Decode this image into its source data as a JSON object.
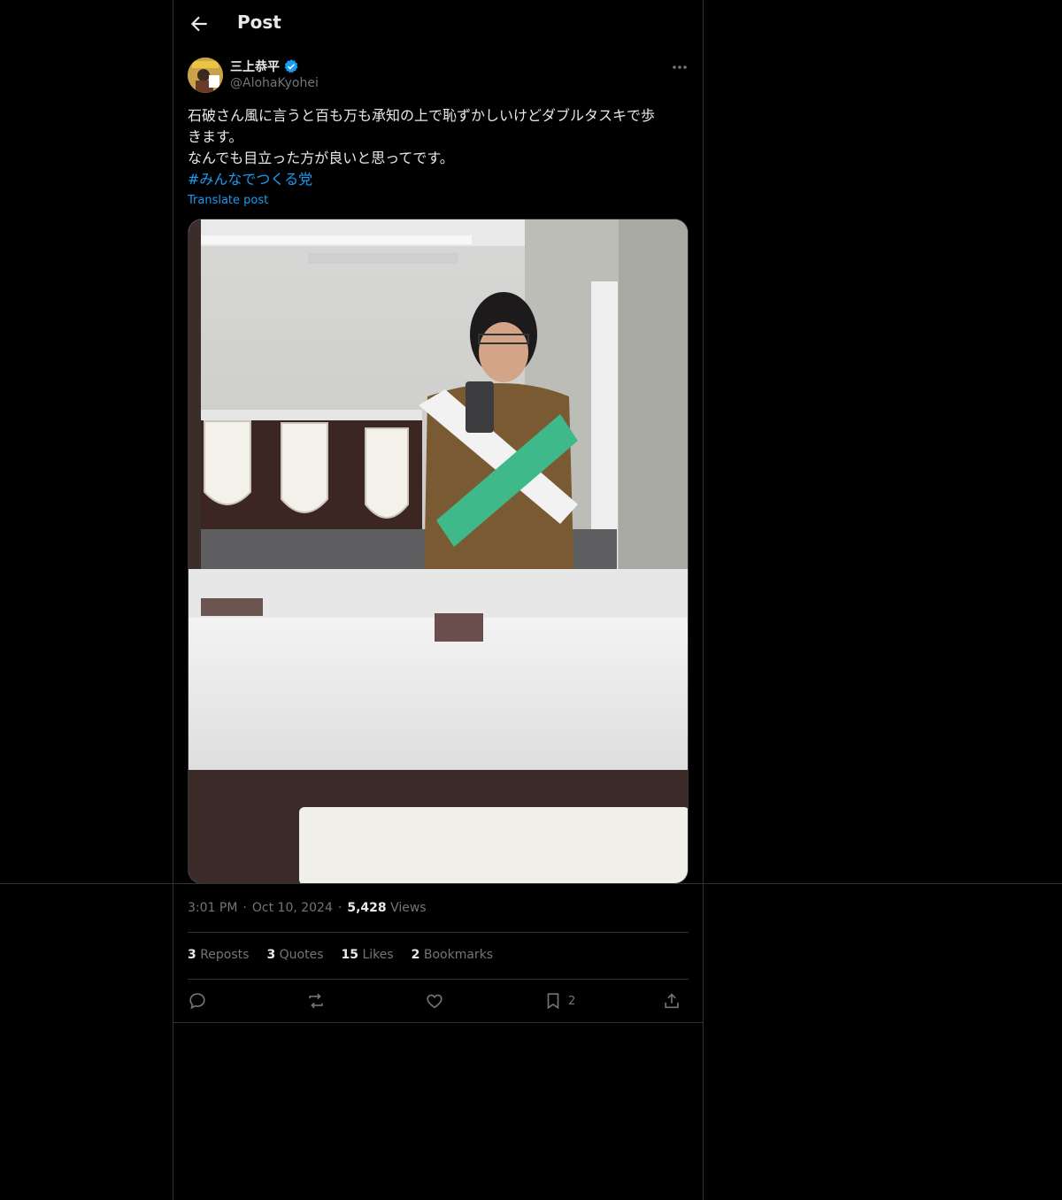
{
  "header": {
    "title": "Post",
    "back_icon": "arrow-left-icon"
  },
  "author": {
    "name": "三上恭平",
    "handle": "@AlohaKyohei",
    "verified": true
  },
  "post": {
    "lines": [
      "石破さん風に言うと百も万も承知の上で恥ずかしいけどダブルタスキで歩",
      "きます。",
      "なんでも目立った方が良いと思ってです。"
    ],
    "hashtag": "#みんなでつくる党",
    "translate_label": "Translate post"
  },
  "meta": {
    "time": "3:01 PM",
    "date": "Oct 10, 2024",
    "views_count": "5,428",
    "views_label": "Views"
  },
  "stats": {
    "reposts_count": "3",
    "reposts_label": "Reposts",
    "quotes_count": "3",
    "quotes_label": "Quotes",
    "likes_count": "15",
    "likes_label": "Likes",
    "bookmarks_count": "2",
    "bookmarks_label": "Bookmarks"
  },
  "actions": {
    "bookmark_count": "2"
  },
  "colors": {
    "accent": "#1d9bf0",
    "background": "#000000",
    "border": "#2f3336",
    "muted": "#71767b",
    "text": "#e7e9ea"
  }
}
